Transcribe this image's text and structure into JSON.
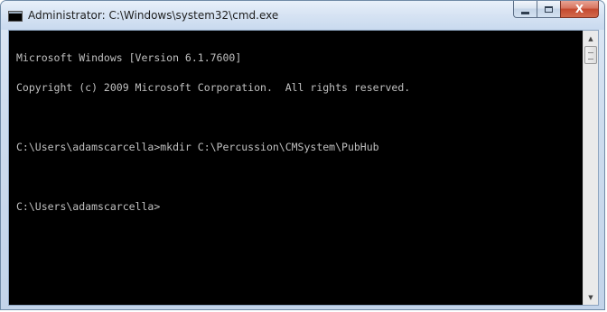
{
  "window": {
    "title": "Administrator: C:\\Windows\\system32\\cmd.exe",
    "icon": "console-icon",
    "controls": {
      "minimize": "minimize-icon",
      "maximize": "maximize-icon",
      "close": "X"
    }
  },
  "console": {
    "lines": [
      "Microsoft Windows [Version 6.1.7600]",
      "Copyright (c) 2009 Microsoft Corporation.  All rights reserved.",
      "",
      "C:\\Users\\adamscarcella>mkdir C:\\Percussion\\CMSystem\\PubHub",
      "",
      "C:\\Users\\adamscarcella>"
    ],
    "background": "#000000",
    "foreground": "#c0c0c0"
  },
  "scrollbar": {
    "up_arrow": "▲",
    "down_arrow": "▼"
  }
}
